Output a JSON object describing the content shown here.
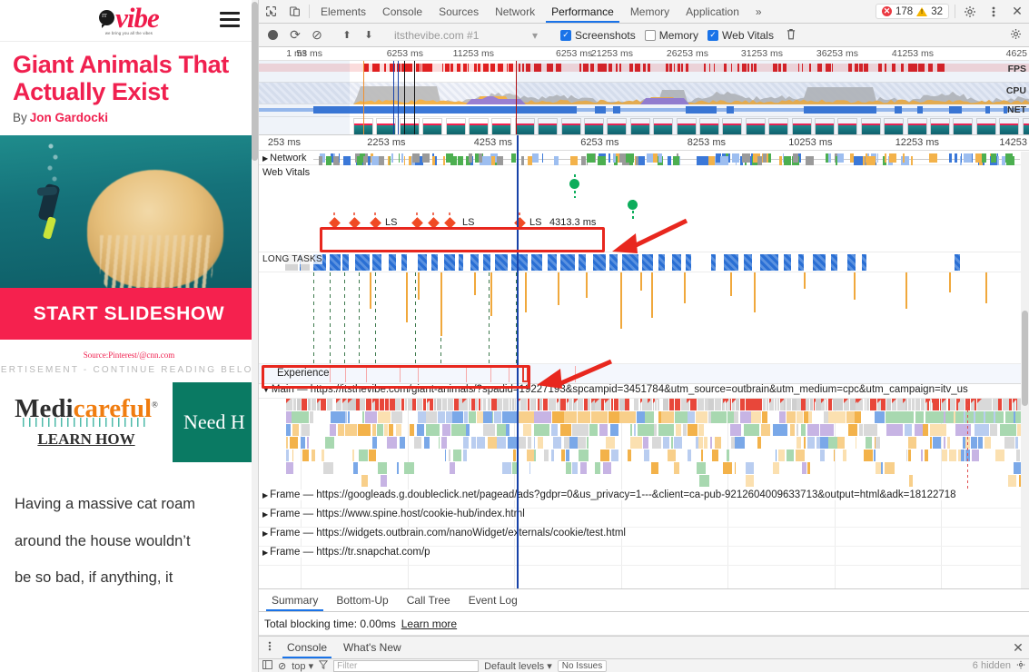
{
  "webpage": {
    "site_name": "vibe",
    "logo_tagline": "we bring you all the vibes",
    "menu_icon": "hamburger-icon",
    "article_title": "Giant Animals That Actually Exist",
    "byline_prefix": "By",
    "author": "Jon Gardocki",
    "slideshow_button": "START SLIDESHOW",
    "image_source": "Source:Pinterest/@cnn.com",
    "ad_label": "VERTISEMENT - CONTINUE READING BELO",
    "ad_brand_part1": "Medi",
    "ad_brand_part2": "careful",
    "ad_brand_reg": "®",
    "ad_cta": "LEARN HOW",
    "ad_right_text": "Need H",
    "body_lines": [
      "Having a massive cat roam",
      "around the house wouldn’t",
      "be so bad, if anything, it"
    ]
  },
  "devtools": {
    "inspect_icon": "inspect-element-icon",
    "device_icon": "device-toolbar-icon",
    "tabs": [
      {
        "label": "Elements",
        "active": false
      },
      {
        "label": "Console",
        "active": false
      },
      {
        "label": "Sources",
        "active": false
      },
      {
        "label": "Network",
        "active": false
      },
      {
        "label": "Performance",
        "active": true
      },
      {
        "label": "Memory",
        "active": false
      },
      {
        "label": "Application",
        "active": false
      }
    ],
    "more_tabs_icon": "»",
    "error_count": "178",
    "warning_count": "32",
    "settings_icon": "gear-icon",
    "menu_icon": "kebab-icon",
    "close_icon": "✕",
    "toolbar": {
      "record_icon": "record-circle-icon",
      "reload_icon": "⟳",
      "clear_icon": "⊘",
      "upload_icon": "⬆",
      "download_icon": "⬇",
      "profile_select": "itsthevibe.com #1",
      "dropdown_caret": "▾",
      "screenshots_label": "Screenshots",
      "screenshots_checked": true,
      "memory_label": "Memory",
      "memory_checked": false,
      "webvitals_label": "Web Vitals",
      "webvitals_checked": true,
      "trash_icon": "🗑",
      "capture_settings_icon": "gear-icon"
    },
    "overview": {
      "ticks": [
        "1 ms",
        "53 ms",
        "6253 ms",
        "11253 ms",
        "6253 ms",
        "21253 ms",
        "26253 ms",
        "31253 ms",
        "36253 ms",
        "41253 ms",
        "4625"
      ],
      "lane_labels": [
        "FPS",
        "CPU",
        "NET"
      ]
    },
    "timeline": {
      "ruler_ticks": [
        "253 ms",
        "2253 ms",
        "4253 ms",
        "6253 ms",
        "8253 ms",
        "10253 ms",
        "12253 ms",
        "14253"
      ],
      "network_track": "Network",
      "webvitals_track": "Web Vitals",
      "long_tasks_track": "LONG TASKS",
      "ls_labels": [
        "LS",
        "LS",
        "LS"
      ],
      "ls_value": "4313.3 ms",
      "experience_track": "Experience",
      "main_track_prefix": "Main",
      "main_track_url": "— https://itsthevibe.com/giant-animals/?spadid=19227193&spcampid=3451784&utm_source=outbrain&utm_medium=cpc&utm_campaign=itv_us",
      "frames": [
        {
          "label": "Frame",
          "url": "— https://googleads.g.doubleclick.net/pagead/ads?gdpr=0&us_privacy=1---&client=ca-pub-9212604009633713&output=html&adk=18122718"
        },
        {
          "label": "Frame",
          "url": "— https://www.spine.host/cookie-hub/index.html"
        },
        {
          "label": "Frame",
          "url": "— https://widgets.outbrain.com/nanoWidget/externals/cookie/test.html"
        },
        {
          "label": "Frame",
          "url": "— https://tr.snapchat.com/p"
        }
      ]
    },
    "summary": {
      "tabs": [
        {
          "label": "Summary",
          "active": true
        },
        {
          "label": "Bottom-Up",
          "active": false
        },
        {
          "label": "Call Tree",
          "active": false
        },
        {
          "label": "Event Log",
          "active": false
        }
      ],
      "total_blocking_time": "Total blocking time: 0.00ms",
      "learn_more": "Learn more"
    },
    "drawer": {
      "kebab_icon": "kebab-icon",
      "tabs": [
        {
          "label": "Console",
          "active": true
        },
        {
          "label": "What's New",
          "active": false
        }
      ],
      "close_icon": "✕",
      "console_bar": {
        "sidebar_icon": "console-sidebar-icon",
        "clear_icon": "⊘",
        "context": "top",
        "context_caret": "▾",
        "filter_icon": "filter-icon",
        "filter_placeholder": "Filter",
        "levels": "Default levels",
        "levels_caret": "▾",
        "issues": "No Issues",
        "hidden": "6 hidden",
        "settings_icon": "gear-icon"
      }
    },
    "accent_colors": {
      "tab_active": "#1a73e8",
      "error_red": "#eb3941",
      "warning_yellow": "#f5b400",
      "annotation_red": "#e8271e",
      "playhead_blue": "#1742a8",
      "long_task_blue": "#2a6fd4",
      "web_vital_green": "#0cad5b",
      "ls_diamond": "#f04a24"
    }
  }
}
